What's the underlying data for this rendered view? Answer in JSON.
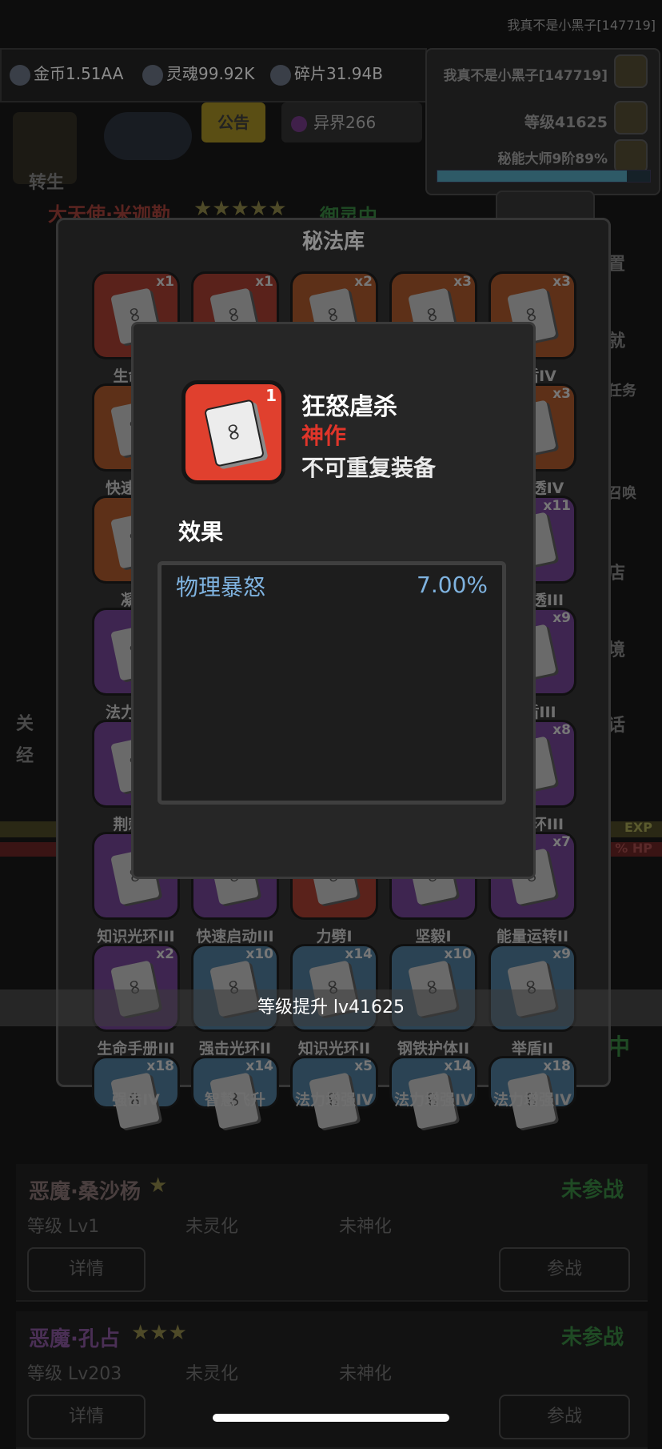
{
  "top_player_name": "我真不是小黑子[147719]",
  "resources": [
    {
      "icon": "coin-icon",
      "label": "金币1.51AA"
    },
    {
      "icon": "soul-icon",
      "label": "灵魂99.92K"
    },
    {
      "icon": "shard-icon",
      "label": "碎片31.94B"
    }
  ],
  "player_panel": {
    "name": "我真不是小黑子[147719]",
    "level": "等级41625",
    "title": "秘能大师9阶89%",
    "progress": 0.89
  },
  "notice_button": "公告",
  "world_button": "异界266",
  "background": {
    "rebirth_label": "转生",
    "hero_name": "大天使·米迦勒",
    "hero_status": "御灵中",
    "side_labels": [
      "置",
      "就",
      "任务",
      "召唤",
      "店",
      "境",
      "话"
    ],
    "left_labels": [
      "关",
      "经"
    ],
    "exp_label": "EXP",
    "hp_label": "% HP",
    "hero_status_2": "中",
    "characters": [
      {
        "name": "恶魔·桑沙杨",
        "stars": "★",
        "status": "未参战",
        "level": "等级 Lv1",
        "spirit": "未灵化",
        "divine": "未神化",
        "detail_btn": "详情",
        "join_btn": "参战",
        "name_color": "#4a3f3f"
      },
      {
        "name": "恶魔·孔占",
        "stars": "★★★",
        "status": "未参战",
        "level": "等级 Lv203",
        "spirit": "未灵化",
        "divine": "未神化",
        "detail_btn": "详情",
        "join_btn": "参战",
        "name_color": "#4a2f55"
      }
    ]
  },
  "library": {
    "title": "秘法库",
    "slots": [
      {
        "rarity": "red",
        "count": "x1",
        "name": "生命…"
      },
      {
        "rarity": "red",
        "count": "x1",
        "name": ""
      },
      {
        "rarity": "orange",
        "count": "x2",
        "name": ""
      },
      {
        "rarity": "orange",
        "count": "x3",
        "name": ""
      },
      {
        "rarity": "orange",
        "count": "x3",
        "name": "…盾IV"
      },
      {
        "rarity": "orange",
        "count": "",
        "name": "快速启…"
      },
      {
        "rarity": "orange",
        "count": "x3",
        "name": "…穿透IV"
      },
      {
        "rarity": "orange",
        "count": "",
        "name": "凝…"
      },
      {
        "rarity": "purple",
        "count": "x11",
        "name": "…穿透III"
      },
      {
        "rarity": "purple",
        "count": "",
        "name": "法力增…"
      },
      {
        "rarity": "purple",
        "count": "x9",
        "name": "…盾III"
      },
      {
        "rarity": "purple",
        "count": "",
        "name": "荆棘…"
      },
      {
        "rarity": "purple",
        "count": "x8",
        "name": "…光环III"
      },
      {
        "rarity": "purple",
        "count": "",
        "name": "知识光环III"
      },
      {
        "rarity": "purple",
        "count": "",
        "name": "快速启动III"
      },
      {
        "rarity": "red",
        "count": "",
        "name": "力劈I"
      },
      {
        "rarity": "purple",
        "count": "",
        "name": "坚毅I"
      },
      {
        "rarity": "purple",
        "count": "x7",
        "name": "能量运转II"
      },
      {
        "rarity": "purple",
        "count": "x2",
        "name": "生命手册III"
      },
      {
        "rarity": "blue",
        "count": "x10",
        "name": "强击光环II"
      },
      {
        "rarity": "blue",
        "count": "x14",
        "name": "知识光环II"
      },
      {
        "rarity": "blue",
        "count": "x10",
        "name": "钢铁护体II"
      },
      {
        "rarity": "blue",
        "count": "x9",
        "name": "举盾II"
      },
      {
        "rarity": "blue",
        "count": "x18",
        "name": "强击IV"
      },
      {
        "rarity": "blue",
        "count": "x14",
        "name": "智慧飞升"
      },
      {
        "rarity": "blue",
        "count": "x5",
        "name": "法力增强IV"
      },
      {
        "rarity": "blue",
        "count": "x14",
        "name": "法力增强IV"
      },
      {
        "rarity": "blue",
        "count": "x18",
        "name": "法力增强IV"
      }
    ]
  },
  "popup": {
    "icon": "arcane-book-icon",
    "count": "1",
    "name": "狂怒虐杀",
    "rarity": "神作",
    "equip_note": "不可重复装备",
    "effect_title": "效果",
    "effect_name": "物理暴怒",
    "effect_value": "7.00%"
  },
  "toast": "等级提升 lv41625",
  "colors": {
    "rarity_red": "#e0402e",
    "rarity_text": "#e0352a",
    "effect_text": "#7fb3e0"
  }
}
